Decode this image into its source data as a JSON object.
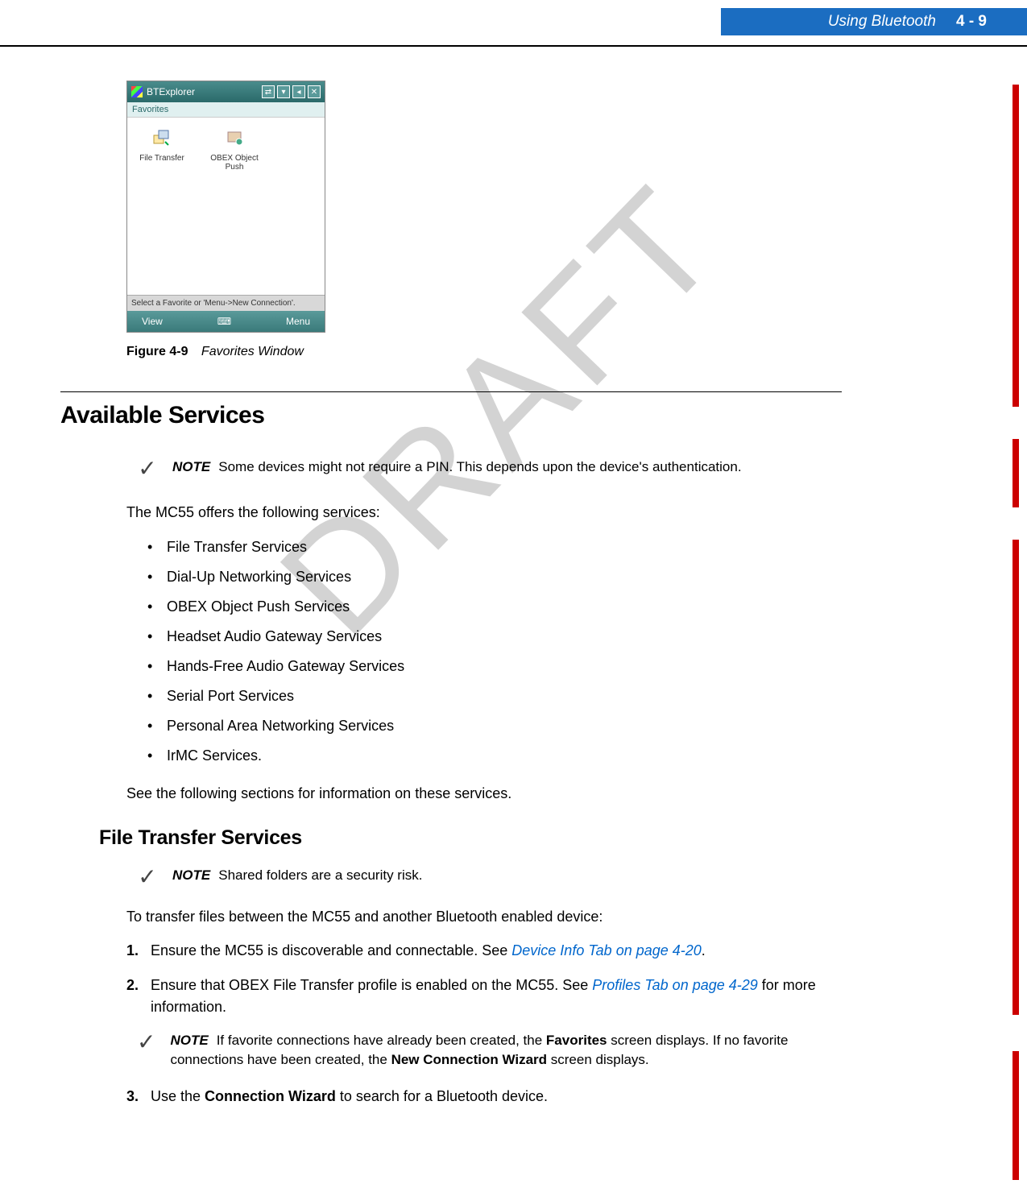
{
  "header": {
    "chapter": "Using Bluetooth",
    "page": "4 - 9"
  },
  "bt_window": {
    "title": "BTExplorer",
    "tab": "Favorites",
    "items": [
      {
        "label": "File Transfer"
      },
      {
        "label": "OBEX Object Push"
      }
    ],
    "status": "Select a Favorite or 'Menu->New Connection'.",
    "softkeys": {
      "left": "View",
      "right": "Menu"
    }
  },
  "figure": {
    "num": "Figure 4-9",
    "title": "Favorites Window"
  },
  "section": {
    "h2": "Available Services",
    "note1_label": "NOTE",
    "note1_text": "Some devices might not require a PIN. This depends upon the device's authentication.",
    "intro": "The MC55 offers the following services:",
    "bullets": [
      "File Transfer Services",
      "Dial-Up Networking Services",
      "OBEX Object Push Services",
      "Headset Audio Gateway Services",
      "Hands-Free Audio Gateway Services",
      "Serial Port Services",
      "Personal Area Networking Services",
      "IrMC Services."
    ],
    "outro": "See the following sections for information on these services."
  },
  "sub": {
    "h3": "File Transfer Services",
    "note2_label": "NOTE",
    "note2_text": "Shared folders are a security risk.",
    "intro2": "To transfer files between the MC55 and another Bluetooth enabled device:",
    "steps": {
      "s1_num": "1.",
      "s1_a": "Ensure the MC55 is discoverable and connectable. See ",
      "s1_link": "Device Info Tab on page 4-20",
      "s1_b": ".",
      "s2_num": "2.",
      "s2_a": "Ensure that OBEX File Transfer profile is enabled on the MC55. See ",
      "s2_link": "Profiles Tab on page 4-29",
      "s2_b": " for more information.",
      "s3_num": "3.",
      "s3_a": "Use the ",
      "s3_bold": "Connection Wizard",
      "s3_b": " to search for a Bluetooth device."
    },
    "note3_label": "NOTE",
    "note3_a": "If favorite connections have already been created, the ",
    "note3_b1": "Favorites",
    "note3_c": " screen displays. If no favorite connections have been created, the ",
    "note3_b2": "New Connection Wizard",
    "note3_d": " screen displays."
  },
  "watermark": "DRAFT"
}
